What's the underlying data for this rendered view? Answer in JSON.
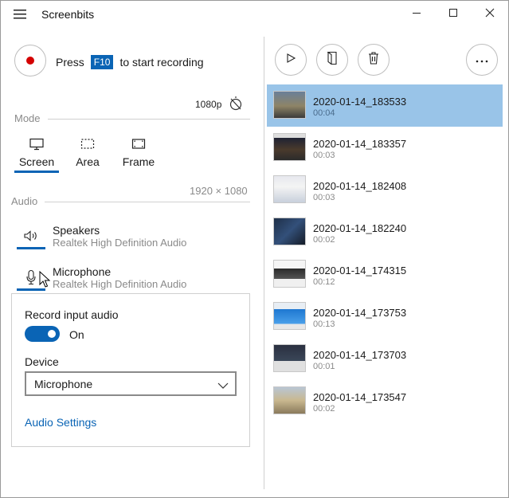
{
  "app": {
    "title": "Screenbits"
  },
  "titlebar": {
    "menu_icon": "hamburger-icon",
    "minimize_icon": "minimize-icon",
    "maximize_icon": "maximize-icon",
    "close_icon": "close-icon"
  },
  "record": {
    "press_label": "Press",
    "key_label": "F10",
    "start_text": "to start recording"
  },
  "quality": {
    "resolution": "1080p",
    "cursor_toggle_icon": "no-cursor-icon"
  },
  "mode": {
    "label": "Mode",
    "tabs": [
      {
        "label": "Screen",
        "icon": "monitor-icon",
        "selected": true
      },
      {
        "label": "Area",
        "icon": "area-select-icon",
        "selected": false
      },
      {
        "label": "Frame",
        "icon": "frame-icon",
        "selected": false
      }
    ],
    "dimensions": "1920 × 1080"
  },
  "audio": {
    "label": "Audio",
    "sources": [
      {
        "name": "Speakers",
        "device": "Realtek High Definition Audio",
        "icon": "speaker-icon"
      },
      {
        "name": "Microphone",
        "device": "Realtek High Definition Audio",
        "icon": "microphone-icon"
      }
    ]
  },
  "popup": {
    "record_input_label": "Record input audio",
    "toggle_state": "On",
    "device_label": "Device",
    "device_value": "Microphone",
    "settings_link": "Audio Settings"
  },
  "toolbar": {
    "play_icon": "play-icon",
    "open_folder_icon": "open-file-icon",
    "delete_icon": "delete-icon",
    "more_icon": "more-icon"
  },
  "recordings": [
    {
      "name": "2020-01-14_183533",
      "duration": "00:04",
      "selected": true
    },
    {
      "name": "2020-01-14_183357",
      "duration": "00:03",
      "selected": false
    },
    {
      "name": "2020-01-14_182408",
      "duration": "00:03",
      "selected": false
    },
    {
      "name": "2020-01-14_182240",
      "duration": "00:02",
      "selected": false
    },
    {
      "name": "2020-01-14_174315",
      "duration": "00:12",
      "selected": false
    },
    {
      "name": "2020-01-14_173753",
      "duration": "00:13",
      "selected": false
    },
    {
      "name": "2020-01-14_173703",
      "duration": "00:01",
      "selected": false
    },
    {
      "name": "2020-01-14_173547",
      "duration": "00:02",
      "selected": false
    }
  ],
  "colors": {
    "accent": "#0a64b5",
    "record": "#d40000",
    "selection": "#99c4e8"
  }
}
